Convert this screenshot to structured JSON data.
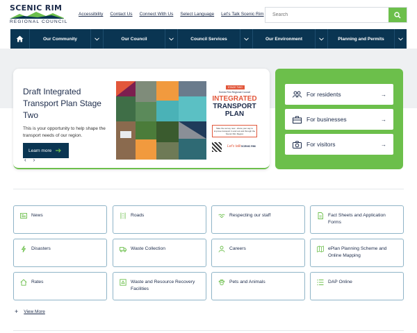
{
  "logo": {
    "title": "SCENIC RIM",
    "subtitle": "REGIONAL COUNCIL"
  },
  "util_links": [
    "Accessibility",
    "Contact Us",
    "Connect With Us",
    "Select Language",
    "Let's Talk Scenic Rim"
  ],
  "search": {
    "placeholder": "Search"
  },
  "nav": {
    "home_icon": "home-icon",
    "items": [
      "Our Community",
      "Our Council",
      "Council Services",
      "Our Environment",
      "Planning and Permits"
    ]
  },
  "feature": {
    "title": "Draft Integrated Transport Plan Stage Two",
    "description": "This is your opportunity to help shape the transport needs of our region.",
    "button": "Learn more",
    "poster": {
      "tag": "STAGE TWO",
      "org": "Scenic Rim Regional Council",
      "title_line1": "INTEGRATED",
      "title_line2": "TRANSPORT",
      "title_line3": "PLAN",
      "box_text": "Take the survey now - share your say to improve transport in and out and through the Scenic Rim Region",
      "lets_talk": "Let's talk",
      "logo": "SCENIC RIM"
    }
  },
  "quick_links": [
    {
      "label": "For residents",
      "icon": "people-icon"
    },
    {
      "label": "For businesses",
      "icon": "briefcase-icon"
    },
    {
      "label": "For visitors",
      "icon": "camera-icon"
    }
  ],
  "tiles": [
    {
      "label": "News",
      "icon": "newspaper-icon"
    },
    {
      "label": "Roads",
      "icon": "road-icon"
    },
    {
      "label": "Respecting our staff",
      "icon": "handshake-icon"
    },
    {
      "label": "Fact Sheets and Application Forms",
      "icon": "document-icon"
    },
    {
      "label": "Disasters",
      "icon": "lightning-icon"
    },
    {
      "label": "Waste Collection",
      "icon": "truck-icon"
    },
    {
      "label": "Careers",
      "icon": "person-icon"
    },
    {
      "label": "ePlan Planning Scheme and Online Mapping",
      "icon": "map-icon"
    },
    {
      "label": "Rates",
      "icon": "house-icon"
    },
    {
      "label": "Waste and Resource Recovery Facilities",
      "icon": "recycle-icon"
    },
    {
      "label": "Pets and Animals",
      "icon": "paw-icon"
    },
    {
      "label": "DAP Online",
      "icon": "list-icon"
    }
  ],
  "view_more": "View More",
  "colors": {
    "navy": "#0a3552",
    "green": "#6cbf4b",
    "tile_border": "#8fb4c7",
    "poster_orange": "#e2573b"
  }
}
